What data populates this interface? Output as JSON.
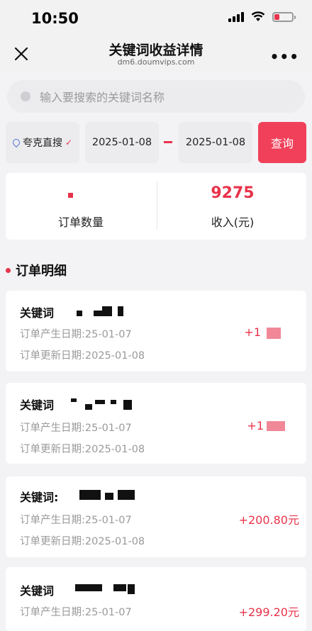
{
  "status_bar": {
    "time": "10:50"
  },
  "nav": {
    "title": "关键词收益详情",
    "subtitle": "dm6.doumvips.com"
  },
  "search": {
    "placeholder": "输入要搜索的关键词名称"
  },
  "filters": {
    "platform": "夸克直搜",
    "start_date": "2025-01-08",
    "end_date": "2025-01-08",
    "query_label": "查询"
  },
  "stats": {
    "order_count_label": "订单数量",
    "income_value": "9275",
    "income_label": "收入(元)"
  },
  "section": {
    "title": "订单明细"
  },
  "orders": [
    {
      "keyword_label": "关键词",
      "created": "订单产生日期:25-01-07",
      "updated": "订单更新日期:2025-01-08",
      "amount": "+1"
    },
    {
      "keyword_label": "关键词",
      "created": "订单产生日期:25-01-07",
      "updated": "订单更新日期:2025-01-08",
      "amount": "+1"
    },
    {
      "keyword_label": "关键词:",
      "created": "订单产生日期:25-01-07",
      "updated": "订单更新日期:2025-01-08",
      "amount": "+200.80元"
    },
    {
      "keyword_label": "关键词",
      "created": "订单产生日期:25-01-07",
      "updated": "",
      "amount": "+299.20元"
    }
  ],
  "colors": {
    "accent": "#e8334a",
    "button": "#f0405a"
  }
}
